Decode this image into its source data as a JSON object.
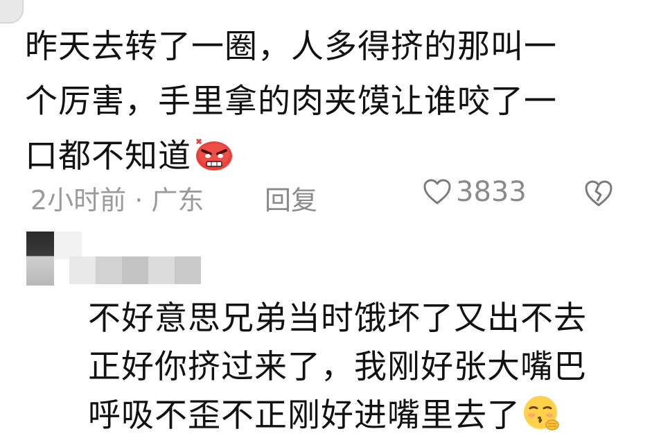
{
  "comment": {
    "lines": [
      "昨天去转了一圈，人多得挤的那叫一",
      "个厉害，手里拿的肉夹馍让谁咬了一",
      "口都不知道"
    ],
    "emoji": "angry-face-emoji"
  },
  "meta": {
    "time_location": "2小时前 · 广东",
    "reply_label": "回复",
    "like_count": "3833",
    "icons": {
      "like": "heart-outline-icon",
      "dislike": "broken-heart-icon"
    }
  },
  "reply": {
    "lines": [
      "不好意思兄弟当时饿坏了又出不去",
      "正好你挤过来了，我刚好张大嘴巴",
      "呼吸不歪不正刚好进嘴里去了"
    ],
    "emoji": "shy-kiss-face-emoji"
  },
  "colors": {
    "text": "#111111",
    "meta": "#9a9a9a",
    "angry_emoji": "#e8403a",
    "shy_emoji": "#ffd24a"
  }
}
